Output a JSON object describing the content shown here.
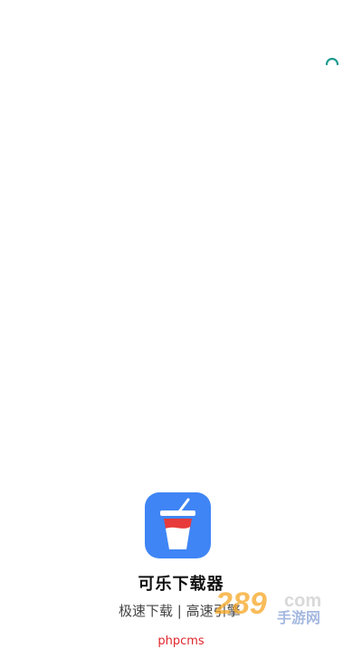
{
  "app": {
    "name": "可乐下载器",
    "tagline": "极速下载 | 高速引擎"
  },
  "icon": {
    "name": "cola-cup-icon",
    "background": "#3f85f5",
    "cup_color": "#ffffff",
    "drink_color": "#e83a3a"
  },
  "loading": {
    "spinner_color": "#1f9b8f"
  },
  "watermark": {
    "logo_text": "289.com 手游网",
    "footer_text": "phpcms"
  }
}
